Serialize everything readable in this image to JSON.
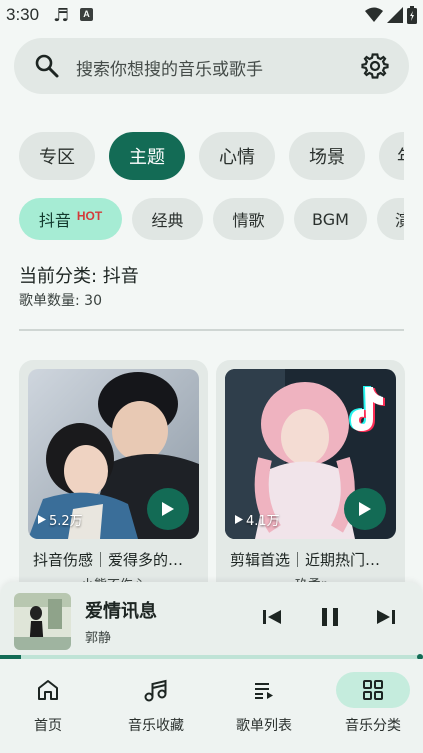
{
  "status_bar": {
    "time": "3:30",
    "icons": [
      "music-note-icon",
      "a-icon",
      "wifi-icon",
      "signal-icon",
      "battery-icon"
    ]
  },
  "search": {
    "placeholder": "搜索你想搜的音乐或歌手",
    "icons": [
      "search-icon",
      "settings-icon"
    ]
  },
  "category_tabs": [
    {
      "label": "专区",
      "active": false
    },
    {
      "label": "主题",
      "active": true
    },
    {
      "label": "心情",
      "active": false
    },
    {
      "label": "场景",
      "active": false
    },
    {
      "label": "年",
      "active": false
    }
  ],
  "sub_tabs": [
    {
      "label": "抖音",
      "badge": "HOT",
      "active": true
    },
    {
      "label": "经典",
      "active": false
    },
    {
      "label": "情歌",
      "active": false
    },
    {
      "label": "BGM",
      "active": false
    },
    {
      "label": "演",
      "active": false
    }
  ],
  "current_category": "当前分类: 抖音",
  "playlist_count": "歌单数量: 30",
  "playlists": [
    {
      "title": "抖音伤感｜爱得多的…",
      "subtitle": "小熊不伤心",
      "play_count": "5.2万"
    },
    {
      "title": "剪辑首选｜近期热门…",
      "subtitle": "玖柔r",
      "play_count": "4.1万"
    }
  ],
  "mini_player": {
    "title": "爱情讯息",
    "artist": "郭静",
    "progress": 0.05
  },
  "bottom_nav": [
    {
      "label": "首页",
      "icon": "home-icon",
      "active": false
    },
    {
      "label": "音乐收藏",
      "icon": "music-notes-icon",
      "active": false
    },
    {
      "label": "歌单列表",
      "icon": "playlist-icon",
      "active": false
    },
    {
      "label": "音乐分类",
      "icon": "grid-icon",
      "active": true
    }
  ],
  "colors": {
    "accent": "#136b55",
    "accent_light": "#a6ecd4",
    "background": "#f3f7f5",
    "hot": "#d43a3a"
  }
}
